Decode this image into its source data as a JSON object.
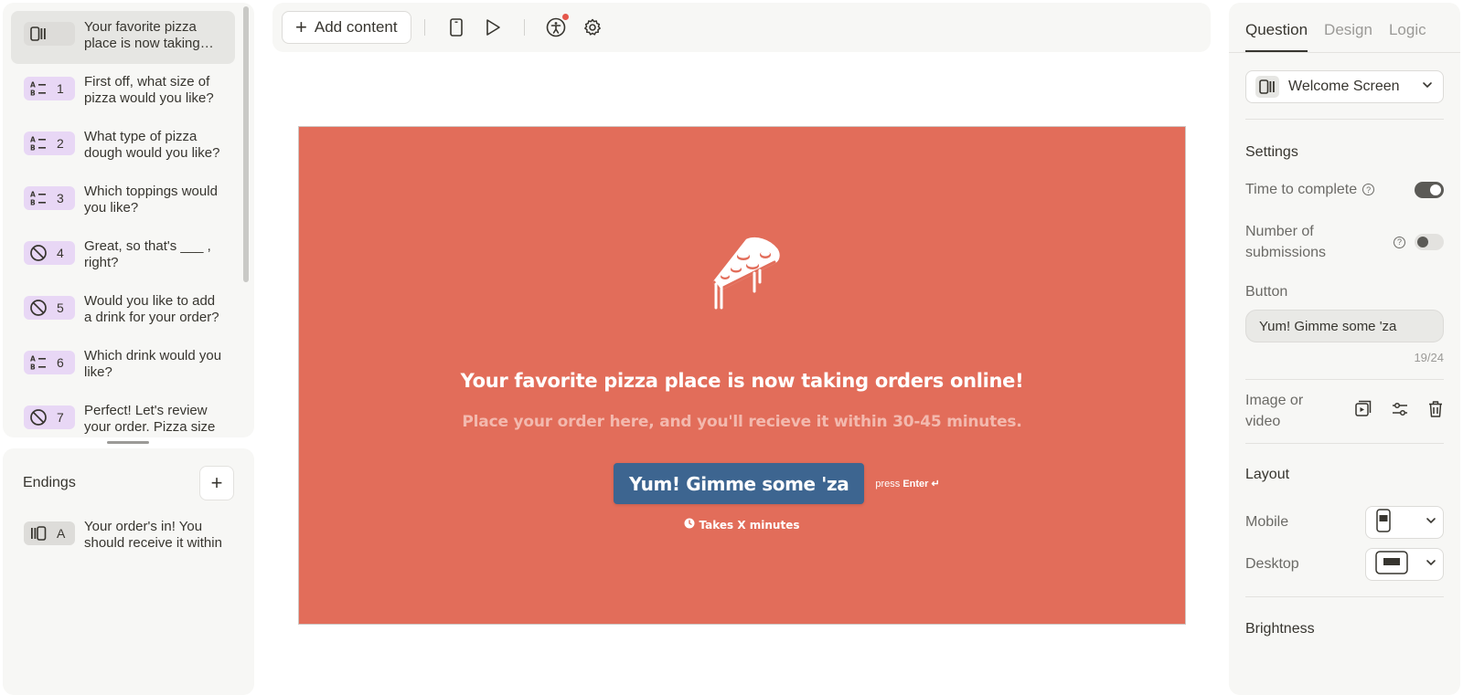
{
  "sidebar": {
    "questions": [
      {
        "type_icon": "welcome-screen-icon",
        "number": "",
        "text": "Your favorite pizza place is now taking orders online!",
        "active": true,
        "badge_color": "gray"
      },
      {
        "type_icon": "multiple-choice-icon",
        "number": "1",
        "text": "First off, what size of pizza would you like?",
        "active": false,
        "badge_color": "purple"
      },
      {
        "type_icon": "multiple-choice-icon",
        "number": "2",
        "text": "What type of pizza dough would you like?",
        "active": false,
        "badge_color": "purple"
      },
      {
        "type_icon": "multiple-choice-icon",
        "number": "3",
        "text": "Which toppings would you like?",
        "active": false,
        "badge_color": "purple"
      },
      {
        "type_icon": "no-answer-icon",
        "number": "4",
        "text": "Great, so that's ___ , right?",
        "active": false,
        "badge_color": "purple"
      },
      {
        "type_icon": "no-answer-icon",
        "number": "5",
        "text": "Would you like to add a drink for your order?",
        "active": false,
        "badge_color": "purple"
      },
      {
        "type_icon": "multiple-choice-icon",
        "number": "6",
        "text": "Which drink would you like?",
        "active": false,
        "badge_color": "purple"
      },
      {
        "type_icon": "no-answer-icon",
        "number": "7",
        "text": "Perfect! Let's review your order. Pizza size",
        "active": false,
        "badge_color": "purple"
      }
    ],
    "endings": {
      "title": "Endings",
      "add_label": "+",
      "items": [
        {
          "type_icon": "ending-screen-icon",
          "letter": "A",
          "text": "Your order's in! You should receive it within"
        }
      ]
    }
  },
  "toolbar": {
    "add_content_label": "Add content",
    "icons": [
      "mobile-preview-icon",
      "play-icon",
      "accessibility-icon",
      "settings-gear-icon"
    ],
    "notification_color": "#e5574b"
  },
  "canvas": {
    "background": "#e26d5a",
    "icon": "pizza-slice-icon",
    "title": "Your favorite pizza place is now taking orders online!",
    "subtitle": "Place your order here, and you'll recieve it within 30-45 minutes.",
    "button_label": "Yum! Gimme some 'za",
    "button_color": "#3d6590",
    "press_hint": "press",
    "press_key": "Enter ↵",
    "time_label": "Takes X minutes"
  },
  "right_panel": {
    "tabs": [
      {
        "label": "Question",
        "active": true
      },
      {
        "label": "Design",
        "active": false
      },
      {
        "label": "Logic",
        "active": false
      }
    ],
    "type_select": {
      "label": "Welcome Screen",
      "icon": "welcome-screen-icon"
    },
    "settings": {
      "title": "Settings",
      "time_to_complete": {
        "label": "Time to complete",
        "on": true
      },
      "number_of_submissions": {
        "label": "Number of submissions",
        "on": false
      }
    },
    "button": {
      "label": "Button",
      "value": "Yum! Gimme some 'za",
      "counter": "19/24"
    },
    "image_or_video": {
      "label": "Image or video",
      "icons": [
        "media-add-icon",
        "adjust-sliders-icon",
        "trash-icon"
      ]
    },
    "layout": {
      "title": "Layout",
      "mobile_label": "Mobile",
      "desktop_label": "Desktop"
    },
    "brightness": {
      "title": "Brightness"
    }
  }
}
